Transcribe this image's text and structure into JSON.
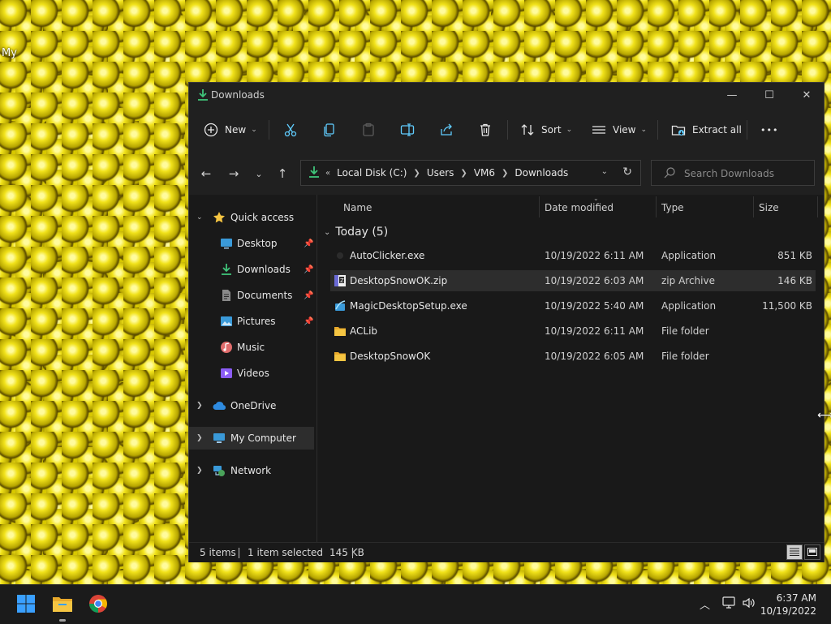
{
  "desktop": {
    "label": "My "
  },
  "window": {
    "title": "Downloads",
    "controls": {
      "minimize": "—",
      "maximize": "☐",
      "close": "✕"
    }
  },
  "toolbar": {
    "new_label": "New",
    "sort_label": "Sort",
    "view_label": "View",
    "extract_label": "Extract all",
    "more_label": "•••"
  },
  "address": {
    "overflow": "«",
    "crumbs": [
      "Local Disk (C:)",
      "Users",
      "VM6",
      "Downloads"
    ]
  },
  "search": {
    "placeholder": "Search Downloads"
  },
  "sidebar": {
    "items": [
      {
        "label": "Quick access",
        "icon": "star-icon"
      },
      {
        "label": "Desktop",
        "icon": "desktop-icon",
        "pinned": true
      },
      {
        "label": "Downloads",
        "icon": "download-icon",
        "pinned": true
      },
      {
        "label": "Documents",
        "icon": "document-icon",
        "pinned": true
      },
      {
        "label": "Pictures",
        "icon": "pictures-icon",
        "pinned": true
      },
      {
        "label": "Music",
        "icon": "music-icon"
      },
      {
        "label": "Videos",
        "icon": "videos-icon"
      },
      {
        "label": "OneDrive",
        "icon": "cloud-icon"
      },
      {
        "label": "My Computer",
        "icon": "computer-icon",
        "selected": true
      },
      {
        "label": "Network",
        "icon": "network-icon"
      }
    ]
  },
  "columns": {
    "name": "Name",
    "date": "Date modified",
    "type": "Type",
    "size": "Size"
  },
  "group": {
    "label": "Today (5)"
  },
  "files": [
    {
      "name": "AutoClicker.exe",
      "date": "10/19/2022 6:11 AM",
      "type": "Application",
      "size": "851 KB",
      "icon": "exe-icon"
    },
    {
      "name": "DesktopSnowOK.zip",
      "date": "10/19/2022 6:03 AM",
      "type": "zip Archive",
      "size": "146 KB",
      "icon": "zip-icon",
      "selected": true
    },
    {
      "name": "MagicDesktopSetup.exe",
      "date": "10/19/2022 5:40 AM",
      "type": "Application",
      "size": "11,500 KB",
      "icon": "setup-icon"
    },
    {
      "name": "ACLib",
      "date": "10/19/2022 6:11 AM",
      "type": "File folder",
      "size": "",
      "icon": "folder-icon"
    },
    {
      "name": "DesktopSnowOK",
      "date": "10/19/2022 6:05 AM",
      "type": "File folder",
      "size": "",
      "icon": "folder-icon"
    }
  ],
  "status": {
    "items": "5 items",
    "selected": "1 item selected",
    "size": "145 KB"
  },
  "taskbar": {
    "time": "6:37 AM",
    "date": "10/19/2022"
  },
  "colors": {
    "accent": "#60cdff",
    "folder": "#f5c542",
    "window_bg": "#191919",
    "selection": "#2d2d2d"
  }
}
